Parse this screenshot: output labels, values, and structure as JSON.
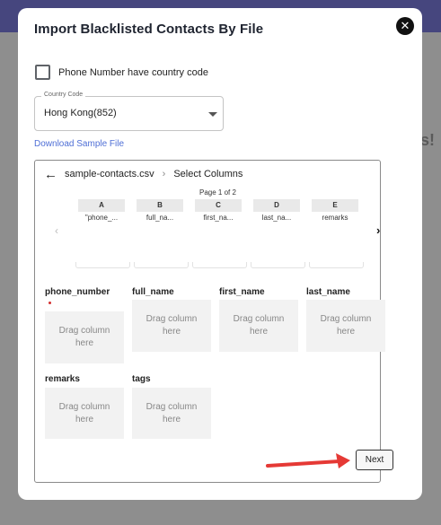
{
  "modal": {
    "title": "Import Blacklisted Contacts By File",
    "close_glyph": "✕"
  },
  "checkbox": {
    "label": "Phone Number have country code",
    "checked": false
  },
  "country_code": {
    "label": "Country Code",
    "value": "Hong Kong(852)"
  },
  "download_link": "Download Sample File",
  "breadcrumb": {
    "file": "sample-contacts.csv",
    "separator": "›",
    "step": "Select Columns"
  },
  "pagination": {
    "text": "Page 1 of 2",
    "prev_glyph": "‹",
    "next_glyph": "›"
  },
  "columns": [
    {
      "letter": "A",
      "header": "\"phone_..."
    },
    {
      "letter": "B",
      "header": "full_na..."
    },
    {
      "letter": "C",
      "header": "first_na..."
    },
    {
      "letter": "D",
      "header": "last_na..."
    },
    {
      "letter": "E",
      "header": "remarks"
    }
  ],
  "fields": [
    {
      "name": "phone_number",
      "required": true,
      "placeholder": "Drag column here"
    },
    {
      "name": "full_name",
      "required": false,
      "placeholder": "Drag column here"
    },
    {
      "name": "first_name",
      "required": false,
      "placeholder": "Drag column here"
    },
    {
      "name": "last_name",
      "required": false,
      "placeholder": "Drag column here"
    },
    {
      "name": "remarks",
      "required": false,
      "placeholder": "Drag column here"
    },
    {
      "name": "tags",
      "required": false,
      "placeholder": "Drag column here"
    }
  ],
  "next_button": "Next",
  "backdrop_glyph": "s!",
  "colors": {
    "accent_link": "#4f6fd6",
    "annotation_arrow": "#e53935",
    "required": "#d32f2f"
  }
}
